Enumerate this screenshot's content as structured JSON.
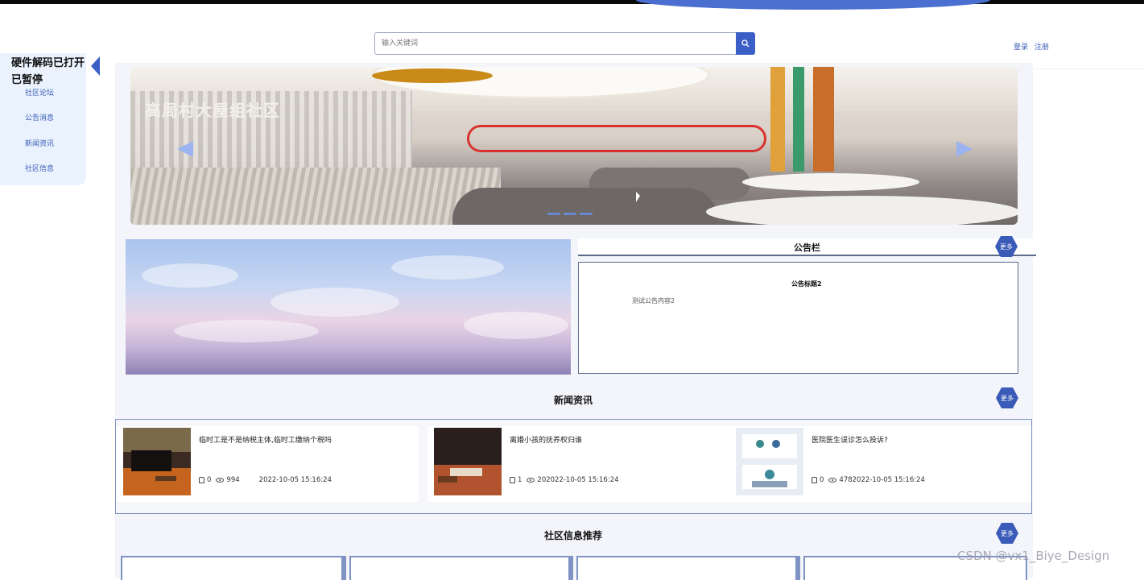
{
  "search": {
    "placeholder": "输入关键词"
  },
  "auth": {
    "login": "登录",
    "register": "注册"
  },
  "sidebar": {
    "overlay_line1": "硬件解码已打开",
    "overlay_line2": "已暂停",
    "items": [
      {
        "label": "社区论坛"
      },
      {
        "label": "公告消息"
      },
      {
        "label": "新闻资讯"
      },
      {
        "label": "社区信息"
      }
    ]
  },
  "banner": {
    "wall_text": "高局村大屋组社区"
  },
  "notice": {
    "title": "公告栏",
    "more": "更多",
    "item_title": "公告标题2",
    "item_body": "测试公告内容2"
  },
  "news": {
    "title": "新闻资讯",
    "more": "更多",
    "items": [
      {
        "title": "临时工是不是纳税主体,临时工缴纳个税吗",
        "likes": "0",
        "views": "994",
        "date": "2022-10-05 15:16:24"
      },
      {
        "title": "离婚小孩的抚养权归谁",
        "likes": "1",
        "views_date": "202022-10-05 15:16:24"
      },
      {
        "title": "医院医生误诊怎么投诉?",
        "likes": "0",
        "views_date": "4782022-10-05 15:16:24"
      }
    ]
  },
  "community": {
    "title": "社区信息推荐",
    "more": "更多"
  },
  "watermark": "CSDN @vx1_Biye_Design",
  "colors": {
    "accent": "#3a5bb8",
    "search_button": "#3b5fc6",
    "border": "#7f93c4"
  }
}
